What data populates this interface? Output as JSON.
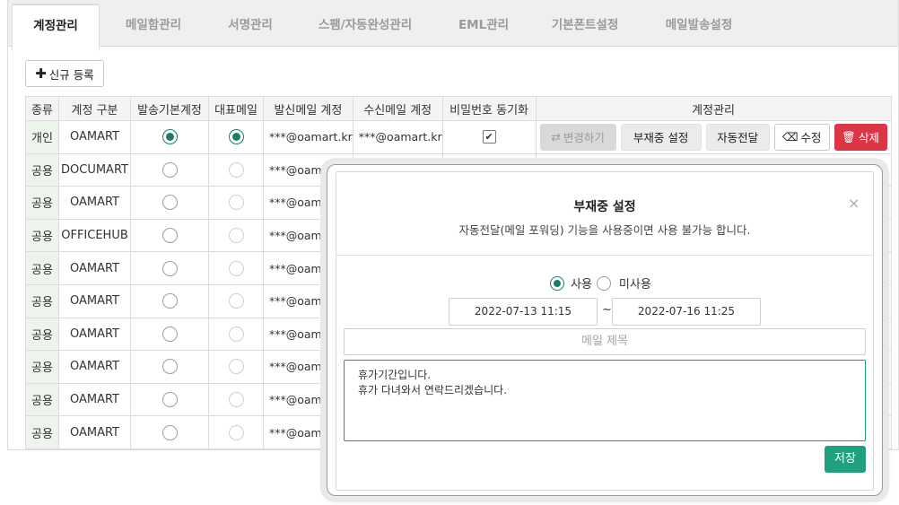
{
  "tabs": [
    {
      "label": "계정관리",
      "active": true
    },
    {
      "label": "메일함관리",
      "active": false
    },
    {
      "label": "서명관리",
      "active": false
    },
    {
      "label": "스팸/자동완성관리",
      "active": false
    },
    {
      "label": "EML관리",
      "active": false
    },
    {
      "label": "기본폰트설정",
      "active": false
    },
    {
      "label": "메일발송설정",
      "active": false
    }
  ],
  "toolbar": {
    "add_label": "신규 등록"
  },
  "table": {
    "headers": [
      "종류",
      "계정 구분",
      "발송기본계정",
      "대표메일",
      "발신메일 계정",
      "수신메일 계정",
      "비밀번호 동기화",
      "계정관리"
    ],
    "rows": [
      {
        "type": "개인",
        "name": "OAMART",
        "default_send": true,
        "primary": true,
        "send_mail": "***@oamart.kr",
        "recv_mail": "***@oamart.kr",
        "pw_sync": true
      },
      {
        "type": "공용",
        "name": "DOCUMART",
        "default_send": false,
        "primary": false,
        "send_mail": "***@oama",
        "recv_mail": "",
        "pw_sync": false
      },
      {
        "type": "공용",
        "name": "OAMART",
        "default_send": false,
        "primary": false,
        "send_mail": "***@oama",
        "recv_mail": "",
        "pw_sync": false
      },
      {
        "type": "공용",
        "name": "OFFICEHUB",
        "default_send": false,
        "primary": false,
        "send_mail": "***@oama",
        "recv_mail": "",
        "pw_sync": false
      },
      {
        "type": "공용",
        "name": "OAMART",
        "default_send": false,
        "primary": false,
        "send_mail": "***@oama",
        "recv_mail": "",
        "pw_sync": false
      },
      {
        "type": "공용",
        "name": "OAMART",
        "default_send": false,
        "primary": false,
        "send_mail": "***@oama",
        "recv_mail": "",
        "pw_sync": false
      },
      {
        "type": "공용",
        "name": "OAMART",
        "default_send": false,
        "primary": false,
        "send_mail": "***@oama",
        "recv_mail": "",
        "pw_sync": false
      },
      {
        "type": "공용",
        "name": "OAMART",
        "default_send": false,
        "primary": false,
        "send_mail": "***@oama",
        "recv_mail": "",
        "pw_sync": false
      },
      {
        "type": "공용",
        "name": "OAMART",
        "default_send": false,
        "primary": false,
        "send_mail": "***@oama",
        "recv_mail": "",
        "pw_sync": false
      },
      {
        "type": "공용",
        "name": "OAMART",
        "default_send": false,
        "primary": false,
        "send_mail": "***@oama",
        "recv_mail": "",
        "pw_sync": false
      }
    ],
    "actions": {
      "change_label": "변경하기",
      "absence_label": "부재중 설정",
      "forward_label": "자동전달",
      "edit_label": "수정",
      "delete_label": "삭제"
    }
  },
  "modal": {
    "title": "부재중 설정",
    "description": "자동전달(메일 포워딩) 기능을 사용중이면 사용 불가능 합니다.",
    "use_label": "사용",
    "unuse_label": "미사용",
    "use_selected": true,
    "start_date": "2022-07-13 11:15",
    "separator": "~",
    "end_date": "2022-07-16 11:25",
    "subject_placeholder": "메일 제목",
    "body_line1": "휴가기간입니다.",
    "body_line2": "휴가 다녀와서 연락드리겠습니다.",
    "save_label": "저장",
    "close_symbol": "×"
  },
  "colors": {
    "accent": "#1d7d68",
    "save": "#1fa07f",
    "delete": "#dc3545",
    "kind_bg": "#edf4ec"
  }
}
